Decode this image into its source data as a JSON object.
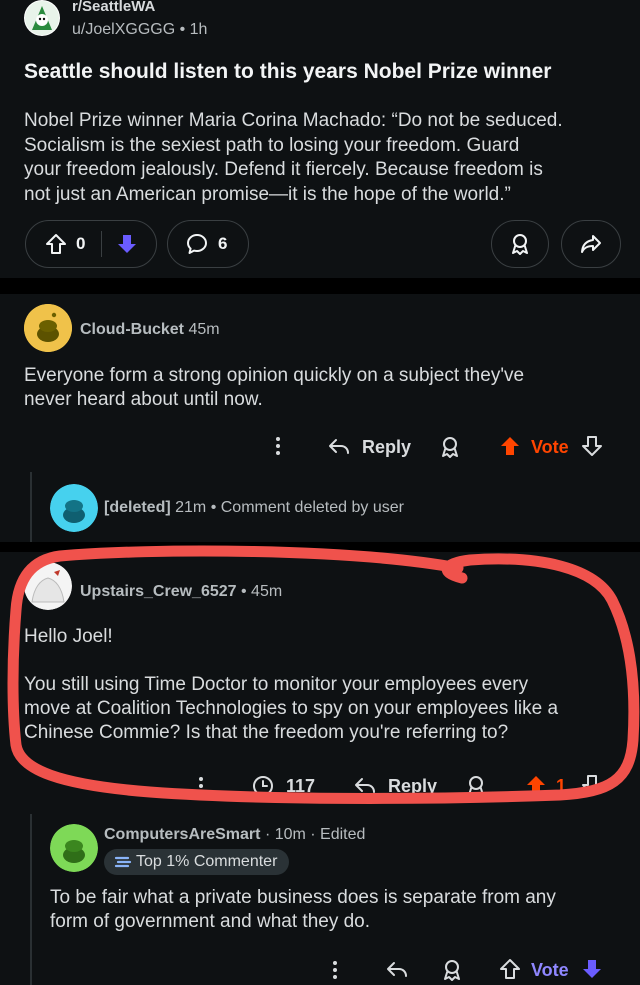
{
  "post": {
    "subreddit": "r/SeattleWA",
    "author": "u/JoelXGGGG",
    "age": "1h",
    "title": "Seattle should listen to this years Nobel Prize winner",
    "body_lines": [
      "Nobel Prize winner Maria Corina Machado: “Do not be seduced.",
      "Socialism is the sexiest path to losing your freedom. Guard",
      "your freedom jealously. Defend it fiercely. Because freedom is",
      "not just an American promise—it is the hope of the world.”"
    ],
    "score": "0",
    "comments": "6"
  },
  "comments": [
    {
      "author": "Cloud-Bucket",
      "age": "45m",
      "body_lines": [
        "Everyone form a strong opinion quickly on a subject they've",
        "never heard about until now."
      ],
      "reply_label": "Reply",
      "vote_label": "Vote"
    },
    {
      "author": "[deleted]",
      "age": "21m",
      "status": "Comment deleted by user"
    },
    {
      "author": "Upstairs_Crew_6527",
      "age": "45m",
      "body_lines": [
        "Hello Joel!",
        "",
        "You still using Time Doctor to monitor your employees every",
        "move at Coalition Technologies to spy on your employees like a",
        "Chinese Commie? Is that the freedom you're referring to?"
      ],
      "views": "117",
      "reply_label": "Reply",
      "score": "1"
    },
    {
      "author": "ComputersAreSmart",
      "age_edited": "· 10m · Edited",
      "flair": "Top 1% Commenter",
      "body_lines": [
        "To be fair what a private business does is separate from any",
        "form of government and what they do."
      ],
      "vote_label": "Vote"
    }
  ],
  "colors": {
    "upvote_orange": "#ff4500",
    "downvote_blue": "#6a5cff",
    "annotation_red": "#f0524c"
  }
}
